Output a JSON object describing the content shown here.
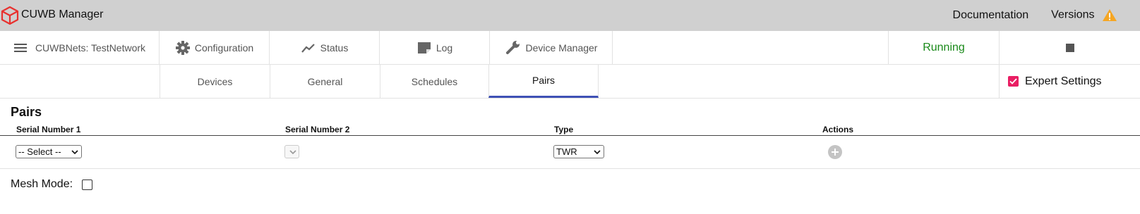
{
  "header": {
    "app_title": "CUWB Manager",
    "links": {
      "documentation": "Documentation",
      "versions": "Versions"
    },
    "brand_color": "#e8312f",
    "warning_color": "#f5a623"
  },
  "nav": {
    "network_label": "CUWBNets: TestNetwork",
    "items": [
      {
        "label": "Configuration",
        "icon": "gear-icon"
      },
      {
        "label": "Status",
        "icon": "trend-line-icon"
      },
      {
        "label": "Log",
        "icon": "note-icon"
      },
      {
        "label": "Device Manager",
        "icon": "wrench-icon"
      }
    ],
    "status_text": "Running",
    "status_color": "#1a8a1a",
    "stop_icon": "stop-icon"
  },
  "tabs": {
    "items": [
      {
        "label": "Devices"
      },
      {
        "label": "General"
      },
      {
        "label": "Schedules"
      },
      {
        "label": "Pairs"
      }
    ],
    "active": "Pairs",
    "accent_color": "#3f51b5",
    "expert_settings_label": "Expert Settings",
    "expert_settings_checked": true
  },
  "pairs": {
    "title": "Pairs",
    "columns": [
      "Serial Number 1",
      "Serial Number 2",
      "Type",
      "Actions"
    ],
    "row": {
      "serial1_value": "-- Select --",
      "serial2_value": "",
      "type_value": "TWR",
      "action_icon": "add-circle-icon"
    },
    "mesh_mode_label": "Mesh Mode:",
    "mesh_mode_checked": false
  }
}
